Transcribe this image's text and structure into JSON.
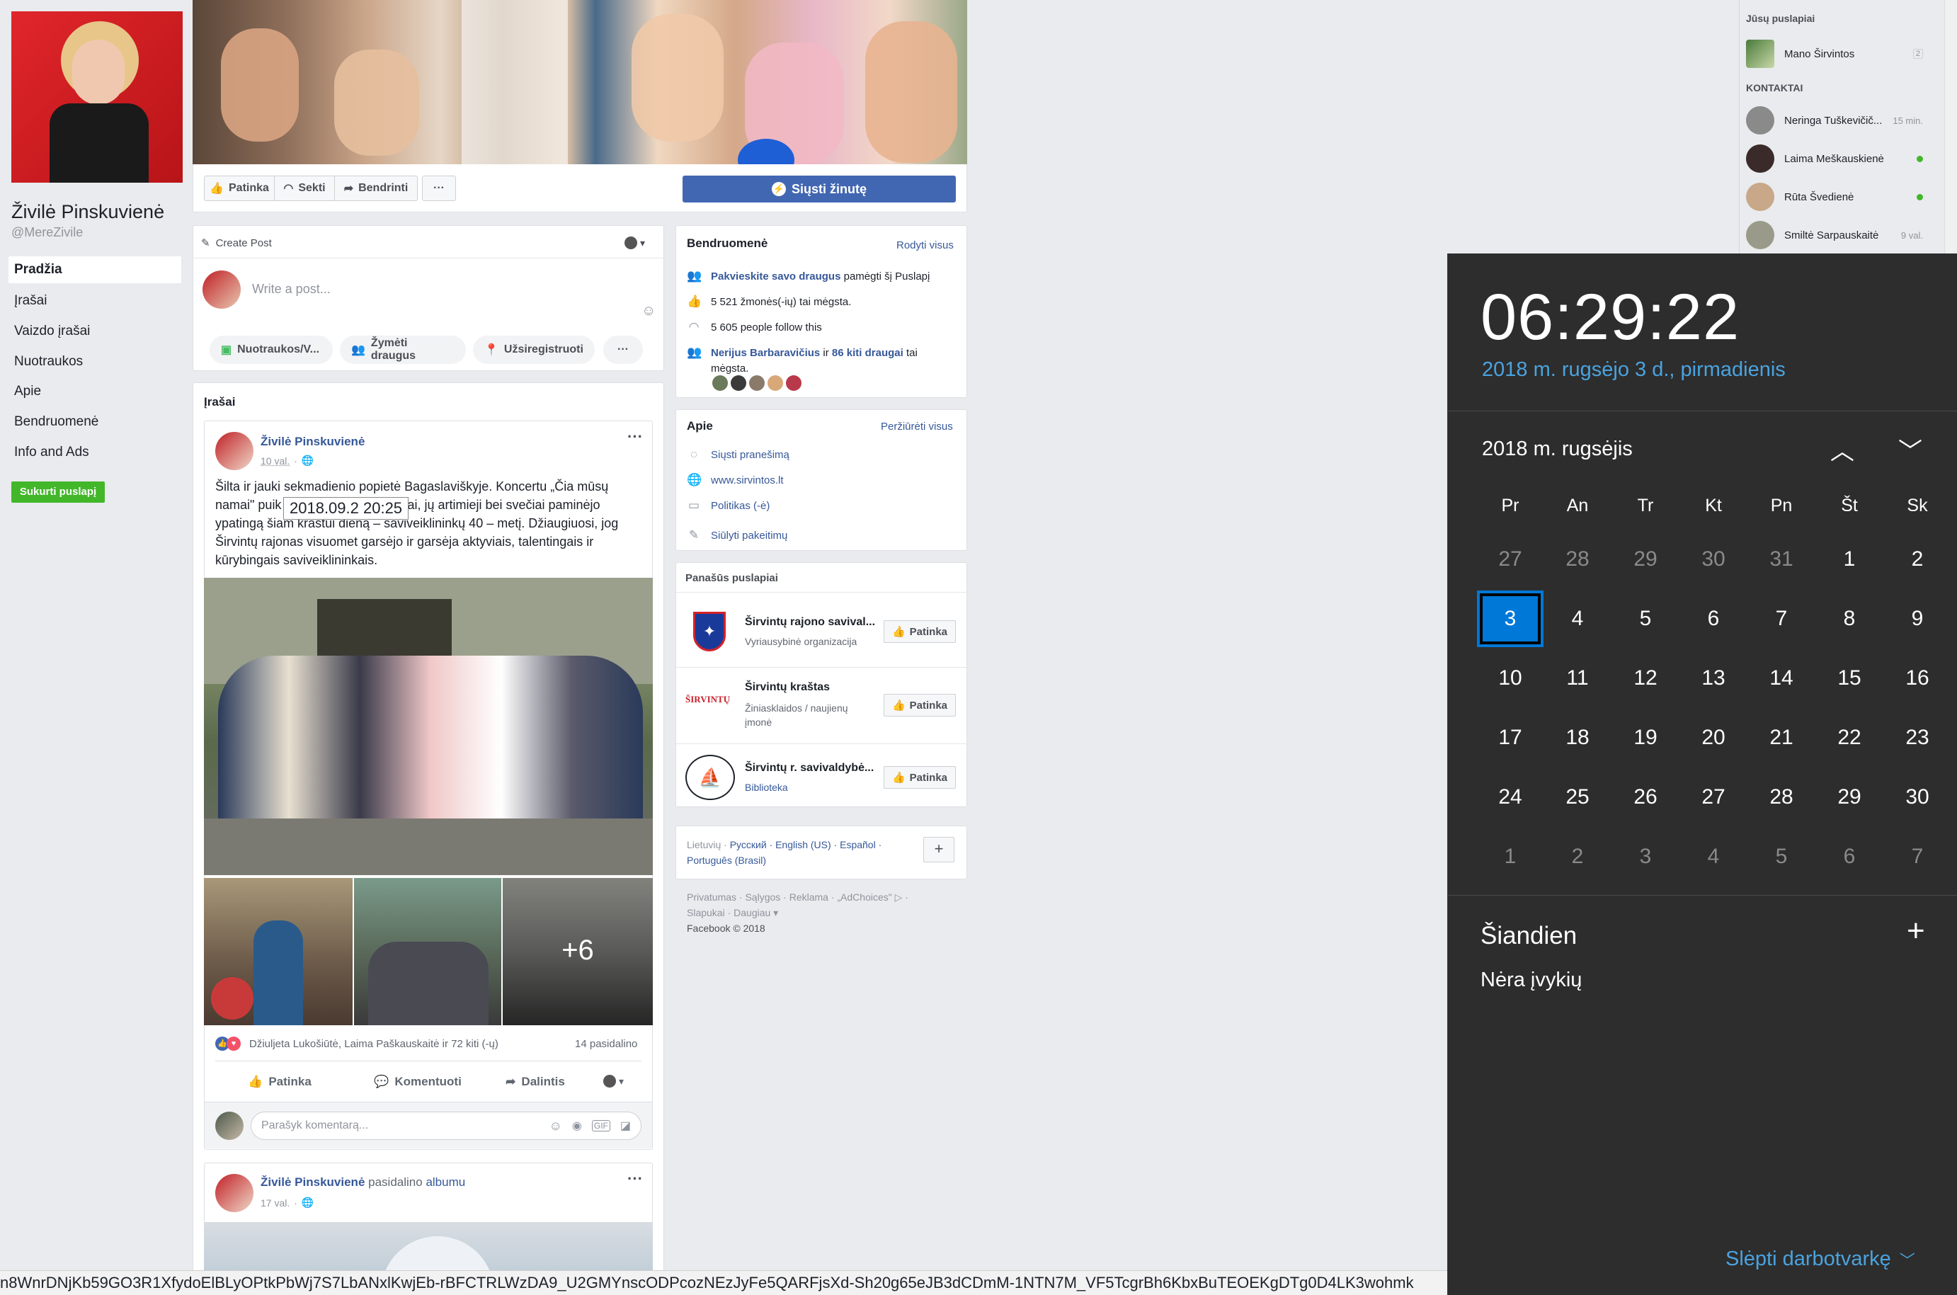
{
  "profile": {
    "name": "Živilė Pinskuvienė",
    "handle": "@MereZivile",
    "nav": [
      "Pradžia",
      "Įrašai",
      "Vaizdo įrašai",
      "Nuotraukos",
      "Apie",
      "Bendruomenė",
      "Info and Ads"
    ],
    "create_page": "Sukurti puslapį"
  },
  "cover_actions": {
    "like": "Patinka",
    "follow": "Sekti",
    "share": "Bendrinti",
    "more": "···",
    "message": "Siųsti žinutę"
  },
  "create_post": {
    "title": "Create Post",
    "placeholder": "Write a post...",
    "actions": [
      "Nuotraukos/V...",
      "Žymėti draugus",
      "Užsiregistruoti",
      "···"
    ]
  },
  "feed": {
    "heading": "Įrašai",
    "post1": {
      "author": "Živilė Pinskuvienė",
      "time": "10 val.",
      "tooltip": "2018.09.2 20:25",
      "text_l1": "Šilta ir jauki sekmadienio popietė Bagaslaviškyje. Koncertu „Čia mūsų",
      "text_l2a": "namai\" puik",
      "text_l2b": "ai, jų artimieji bei svečiai paminėjo",
      "text_l3": "ypatingą šiam kraštui dieną – saviveiklininkų 40 – metį. Džiaugiuosi, jog",
      "text_l4": "Širvintų rajonas visuomet garsėjo ir garsėja aktyviais, talentingais ir",
      "text_l5": "kūrybingais saviveiklininkais.",
      "more_photos": "+6",
      "reactions": "Džiuljeta Lukošiūtė, Laima Paškauskaitė ir 72 kiti (-ų)",
      "shares": "14 pasidalino",
      "like": "Patinka",
      "comment": "Komentuoti",
      "share": "Dalintis",
      "comment_placeholder": "Parašyk komentarą..."
    },
    "post2": {
      "author": "Živilė Pinskuvienė",
      "shared": "pasidalino",
      "album": "albumu",
      "time": "17 val."
    }
  },
  "community": {
    "title": "Bendruomenė",
    "see_all": "Rodyti visus",
    "invite_link": "Pakvieskite savo draugus",
    "invite_rest": "pamėgti šį Puslapį",
    "likes": "5 521 žmonės(-ių) tai mėgsta.",
    "follows": "5 605 people follow this",
    "friends_a": "Nerijus Barbaravičius",
    "friends_b": "ir",
    "friends_c": "86 kiti draugai",
    "friends_d": "tai",
    "friends_e": "mėgsta."
  },
  "about": {
    "title": "Apie",
    "see_all": "Peržiūrėti visus",
    "message": "Siųsti pranešimą",
    "website": "www.sirvintos.lt",
    "politics": "Politikas (-ė)",
    "suggest": "Siūlyti pakeitimų"
  },
  "similar": {
    "title": "Panašūs puslapiai",
    "like": "Patinka",
    "pages": [
      {
        "name": "Širvintų rajono savival...",
        "category": "Vyriausybinė organizacija"
      },
      {
        "name": "Širvintų kraštas",
        "category": "Žiniasklaidos / naujienų įmonė",
        "logo": "ŠIRVINTŲ"
      },
      {
        "name": "Širvintų r. savivaldybė...",
        "category": "Biblioteka"
      }
    ]
  },
  "languages": {
    "current": "Lietuvių ·",
    "list": "Русский · English (US) · Español ·",
    "last": "Português (Brasil)",
    "add": "+"
  },
  "footer": {
    "line1": "Privatumas · Sąlygos · Reklama · „AdChoices\" ▷ ·",
    "line2": "Slapukai · Daugiau ▾",
    "line3": "Facebook © 2018"
  },
  "chat": {
    "your_pages": "Jūsų puslapiai",
    "page": "Mano Širvintos",
    "page_count": "2",
    "contacts": "KONTAKTAI",
    "people": [
      {
        "name": "Neringa Tuškevičič...",
        "status": "15 min."
      },
      {
        "name": "Laima Meškauskienė",
        "status": ""
      },
      {
        "name": "Rūta Švedienė",
        "status": ""
      },
      {
        "name": "Smiltė Sarpauskaitė",
        "status": "9 val."
      }
    ]
  },
  "calendar": {
    "time": "06:29:22",
    "date": "2018 m. rugsėjo 3 d., pirmadienis",
    "month": "2018 m. rugsėjis",
    "weekdays": [
      "Pr",
      "An",
      "Tr",
      "Kt",
      "Pn",
      "Št",
      "Sk"
    ],
    "days": [
      "27",
      "28",
      "29",
      "30",
      "31",
      "1",
      "2",
      "3",
      "4",
      "5",
      "6",
      "7",
      "8",
      "9",
      "10",
      "11",
      "12",
      "13",
      "14",
      "15",
      "16",
      "17",
      "18",
      "19",
      "20",
      "21",
      "22",
      "23",
      "24",
      "25",
      "26",
      "27",
      "28",
      "29",
      "30",
      "1",
      "2",
      "3",
      "4",
      "5",
      "6",
      "7"
    ],
    "today_heading": "Šiandien",
    "no_events": "Nėra įvykių",
    "hide": "Slėpti darbotvarkę",
    "add": "+"
  },
  "status_bar": {
    "url_fragment": "n8WnrDNjKb59GO3R1XfydoElBLyOPtkPbWj7S7LbANxlKwjEb-rBFCTRLWzDA9_U2GMYnscODPcozNEzJyFe5QARFjsXd-Sh20g65eJB3dCDmM-1NTN7M_VF5TcgrBh6KbxBuTEOEKgDTg0D4LK3wohmk"
  },
  "colors": {
    "fb_blue": "#4267b2",
    "link": "#365899",
    "green": "#42b72a",
    "calendar_bg": "#2d2d2d",
    "calendar_accent": "#0078d7",
    "calendar_date": "#4aa3df"
  }
}
